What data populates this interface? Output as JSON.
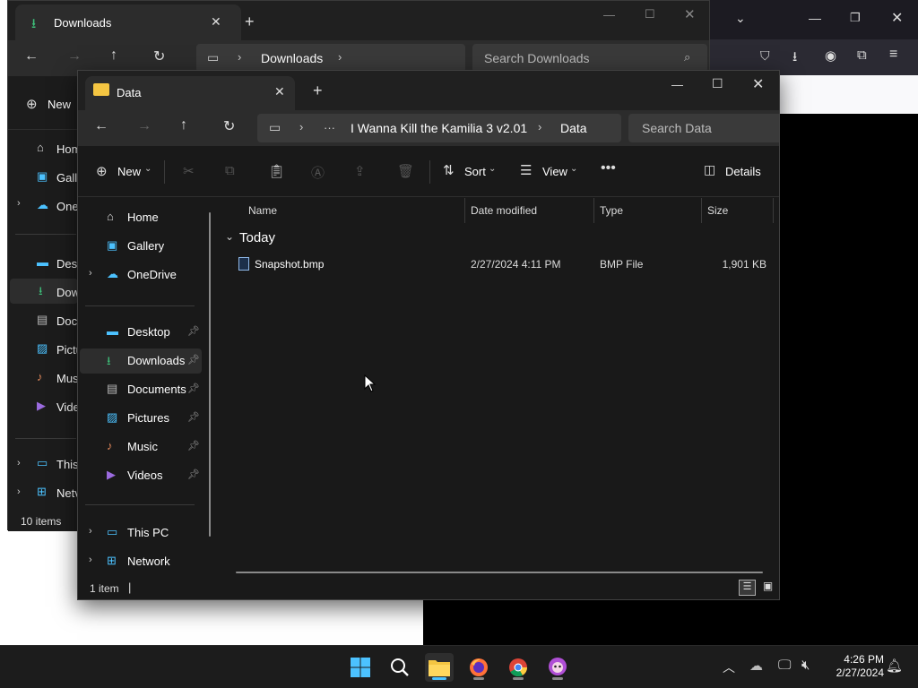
{
  "back_window": {
    "tab_title": "Downloads",
    "address_folder": "Downloads",
    "search_placeholder": "Search Downloads",
    "new_label": "New",
    "sidebar_items": [
      "Hom",
      "Galle",
      "One",
      "Desk",
      "Dow",
      "Docu",
      "Pictu",
      "Mus",
      "Vide",
      "This",
      "Netv"
    ],
    "status": "10 items"
  },
  "front_window": {
    "tab_title": "Data",
    "breadcrumb": {
      "ellipsis": "···",
      "parent": "I Wanna Kill the Kamilia 3 v2.01",
      "current": "Data"
    },
    "search_placeholder": "Search Data",
    "commands": {
      "new": "New",
      "sort": "Sort",
      "view": "View",
      "details": "Details"
    },
    "nav": {
      "home": "Home",
      "gallery": "Gallery",
      "onedrive": "OneDrive",
      "desktop": "Desktop",
      "downloads": "Downloads",
      "documents": "Documents",
      "pictures": "Pictures",
      "music": "Music",
      "videos": "Videos",
      "this_pc": "This PC",
      "network": "Network"
    },
    "columns": {
      "name": "Name",
      "date": "Date modified",
      "type": "Type",
      "size": "Size"
    },
    "group": "Today",
    "files": [
      {
        "name": "Snapshot.bmp",
        "date": "2/27/2024 4:11 PM",
        "type": "BMP File",
        "size": "1,901 KB"
      }
    ],
    "status": "1 item"
  },
  "taskbar": {
    "time": "4:26 PM",
    "date": "2/27/2024"
  },
  "colors": {
    "accent": "#4cc2ff",
    "folder": "#f4c542",
    "downloads_green": "#3ec07a"
  }
}
